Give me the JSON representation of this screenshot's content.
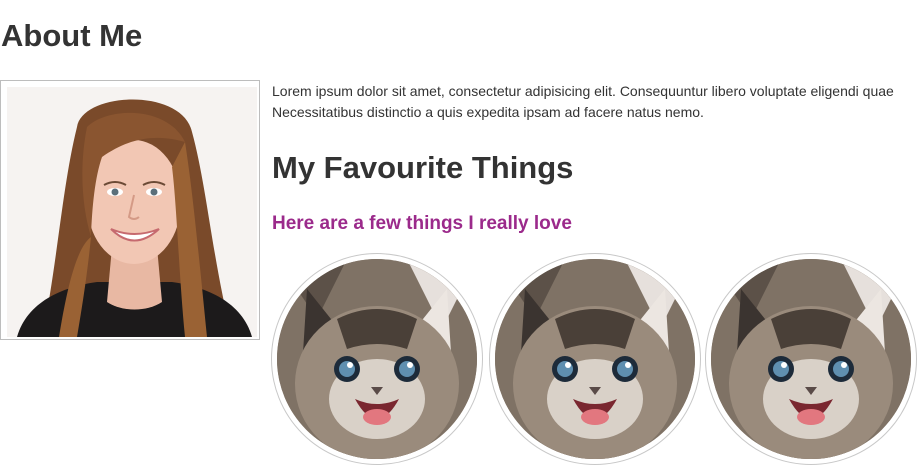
{
  "page": {
    "title": "About Me"
  },
  "profile": {
    "image": "portrait-photo"
  },
  "intro": {
    "line1": "Lorem ipsum dolor sit amet, consectetur adipisicing elit. Consequuntur libero voluptate eligendi quae",
    "line2": "Necessitatibus distinctio a quis expedita ipsam ad facere natus nemo."
  },
  "favourites": {
    "title": "My Favourite Things",
    "subtitle": "Here are a few things I really love",
    "items": [
      {
        "image": "kitten-photo"
      },
      {
        "image": "kitten-photo"
      },
      {
        "image": "kitten-photo"
      }
    ]
  },
  "colors": {
    "text": "#333333",
    "subtitle": "#9b2a8b",
    "border": "#bdbdbd"
  }
}
